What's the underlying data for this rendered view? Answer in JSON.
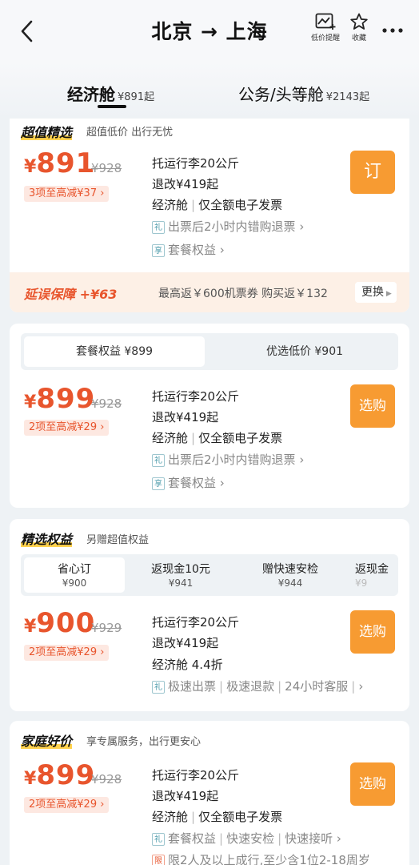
{
  "header": {
    "route": "北京 → 上海",
    "price_alert_label": "低价提醒",
    "favorite_label": "收藏"
  },
  "tabs": [
    {
      "label": "经济舱",
      "price": "¥891起"
    },
    {
      "label": "公务/头等舱",
      "price": "¥2143起"
    }
  ],
  "card1": {
    "title": "超值精选",
    "subtitle": "超值低价 出行无忧",
    "yen": "¥",
    "price": "891",
    "original_price": "¥928",
    "promo": "3项至高减¥37 ›",
    "baggage": "托运行李20公斤",
    "refund": "退改¥419起",
    "cabin": "经济舱",
    "invoice": "仅全额电子发票",
    "gift_icon": "礼",
    "gift_text": "出票后2小时内错购退票 ›",
    "perk_icon": "享",
    "perk_text": "套餐权益 ›",
    "book_label": "订",
    "delay": {
      "title": "延误保障 +¥63",
      "desc": "最高返￥600机票券 购买返￥132",
      "change_label": "更换"
    }
  },
  "card2": {
    "options": [
      {
        "label": "套餐权益 ¥899"
      },
      {
        "label": "优选低价 ¥901"
      }
    ],
    "yen": "¥",
    "price": "899",
    "original_price": "¥928",
    "promo": "2项至高减¥29 ›",
    "baggage": "托运行李20公斤",
    "refund": "退改¥419起",
    "cabin": "经济舱",
    "invoice": "仅全额电子发票",
    "gift_icon": "礼",
    "gift_text": "出票后2小时内错购退票 ›",
    "perk_icon": "享",
    "perk_text": "套餐权益 ›",
    "book_label": "选购"
  },
  "card3": {
    "title": "精选权益",
    "subtitle": "另赠超值权益",
    "options": [
      {
        "name": "省心订",
        "price": "¥900"
      },
      {
        "name": "返现金10元",
        "price": "¥941"
      },
      {
        "name": "赠快速安检",
        "price": "¥944"
      },
      {
        "name": "返现金",
        "price": "¥9"
      }
    ],
    "yen": "¥",
    "price": "900",
    "original_price": "¥929",
    "promo": "2项至高减¥29 ›",
    "baggage": "托运行李20公斤",
    "refund": "退改¥419起",
    "cabin": "经济舱 4.4折",
    "gift_icon": "礼",
    "features": [
      "极速出票",
      "极速退款",
      "24小时客服"
    ],
    "book_label": "选购"
  },
  "card4": {
    "title": "家庭好价",
    "subtitle": "享专属服务，出行更安心",
    "yen": "¥",
    "price": "899",
    "original_price": "¥928",
    "promo": "2项至高减¥29 ›",
    "baggage": "托运行李20公斤",
    "refund": "退改¥419起",
    "cabin": "经济舱",
    "invoice": "仅全额电子发票",
    "gift_icon": "礼",
    "features": [
      "套餐权益",
      "快速安检",
      "快速接听 ›"
    ],
    "limit_icon": "限",
    "limit_text": "限2人及以上成行,至少含1位2-18周岁",
    "book_label": "选购"
  }
}
